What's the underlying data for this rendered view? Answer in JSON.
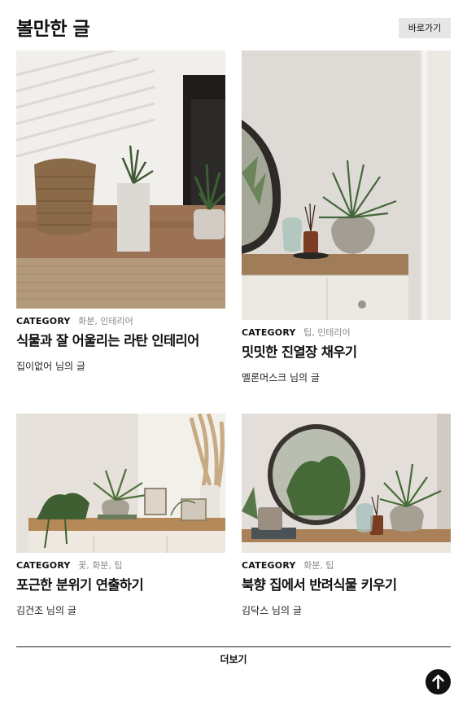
{
  "header": {
    "title": "볼만한 글",
    "go_label": "바로가기"
  },
  "posts": [
    {
      "category": "CATEGORY",
      "tags": "화분, 인테리어",
      "title": "식물과 잘 어울리는 라탄 인테리어",
      "author": "집이없어 님의 글"
    },
    {
      "category": "CATEGORY",
      "tags": "팁, 인테리어",
      "title": "밋밋한 진열장 채우기",
      "author": "멜론머스크 님의 글"
    },
    {
      "category": "CATEGORY",
      "tags": "꽃, 화분, 팁",
      "title": "포근한 분위기 연출하기",
      "author": "김건조 님의 글"
    },
    {
      "category": "CATEGORY",
      "tags": "화분, 팁",
      "title": "북향 집에서 반려식물 키우기",
      "author": "김닥스 님의 글"
    }
  ],
  "more_label": "더보기",
  "icons": {
    "top": "arrow-up-icon"
  },
  "colors": {
    "accent": "#111111",
    "button_bg": "#e6e6e6",
    "tag_text": "#888888"
  }
}
